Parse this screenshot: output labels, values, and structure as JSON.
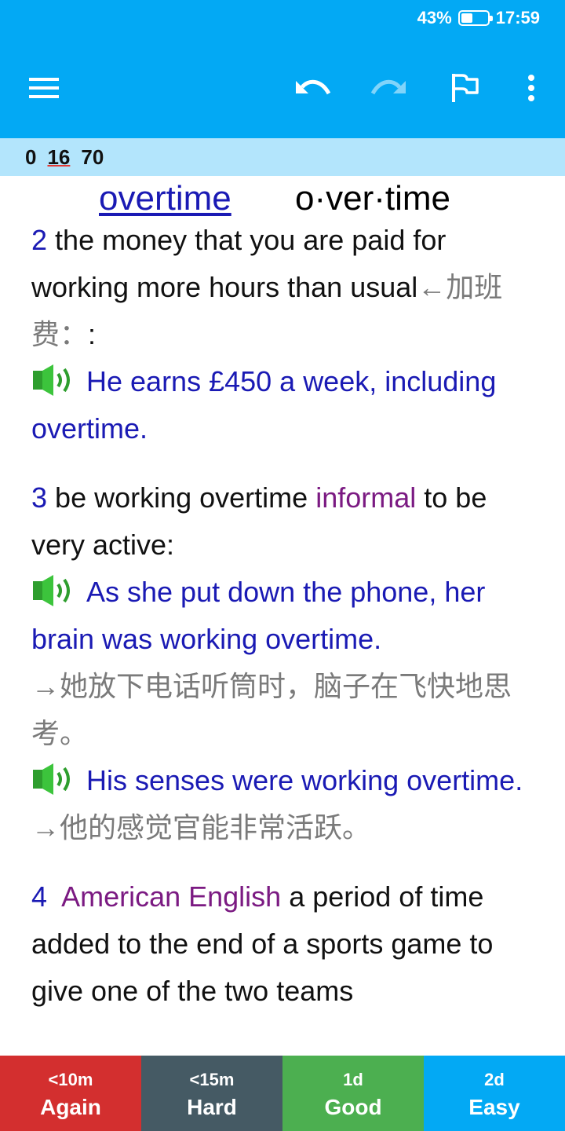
{
  "status": {
    "battery": "43%",
    "battery_level": 0.43,
    "time": "17:59"
  },
  "counter": {
    "new": "0",
    "learning": "16",
    "review": "70"
  },
  "entry": {
    "headword": "overtime",
    "syllables": "o·ver·time",
    "sense2": {
      "num": "2",
      "def": "the money that you are paid for working more hours than usual",
      "cn": "←加班费：",
      "tail": ":",
      "ex1": "He earns £450 a week, including overtime."
    },
    "sense3": {
      "num": "3",
      "lead": "be working overtime",
      "register": "informal",
      "def": "to be very active:",
      "ex1": "As she put down the phone, her brain was working overtime.",
      "ex1_cn": "→她放下电话听筒时，脑子在飞快地思考。",
      "ex2": "His senses were working overtime.",
      "ex2_cn": "→他的感觉官能非常活跃。"
    },
    "sense4": {
      "num": "4",
      "register": "American English",
      "def": "a period of time added to the end of a sports game to give one of the two teams"
    }
  },
  "answers": [
    {
      "time": "<10m",
      "label": "Again"
    },
    {
      "time": "<15m",
      "label": "Hard"
    },
    {
      "time": "1d",
      "label": "Good"
    },
    {
      "time": "2d",
      "label": "Easy"
    }
  ],
  "colors": {
    "primary": "#03a9f4",
    "again": "#d32f2f",
    "hard": "#455a64",
    "good": "#4caf50",
    "easy": "#03a9f4",
    "link": "#1a1ab4",
    "register": "#7b1a82"
  },
  "icons": {
    "menu": "menu-icon",
    "undo": "undo-icon",
    "redo": "redo-icon",
    "flag": "flag-icon",
    "more": "more-vert-icon",
    "speaker": "speaker-icon"
  }
}
